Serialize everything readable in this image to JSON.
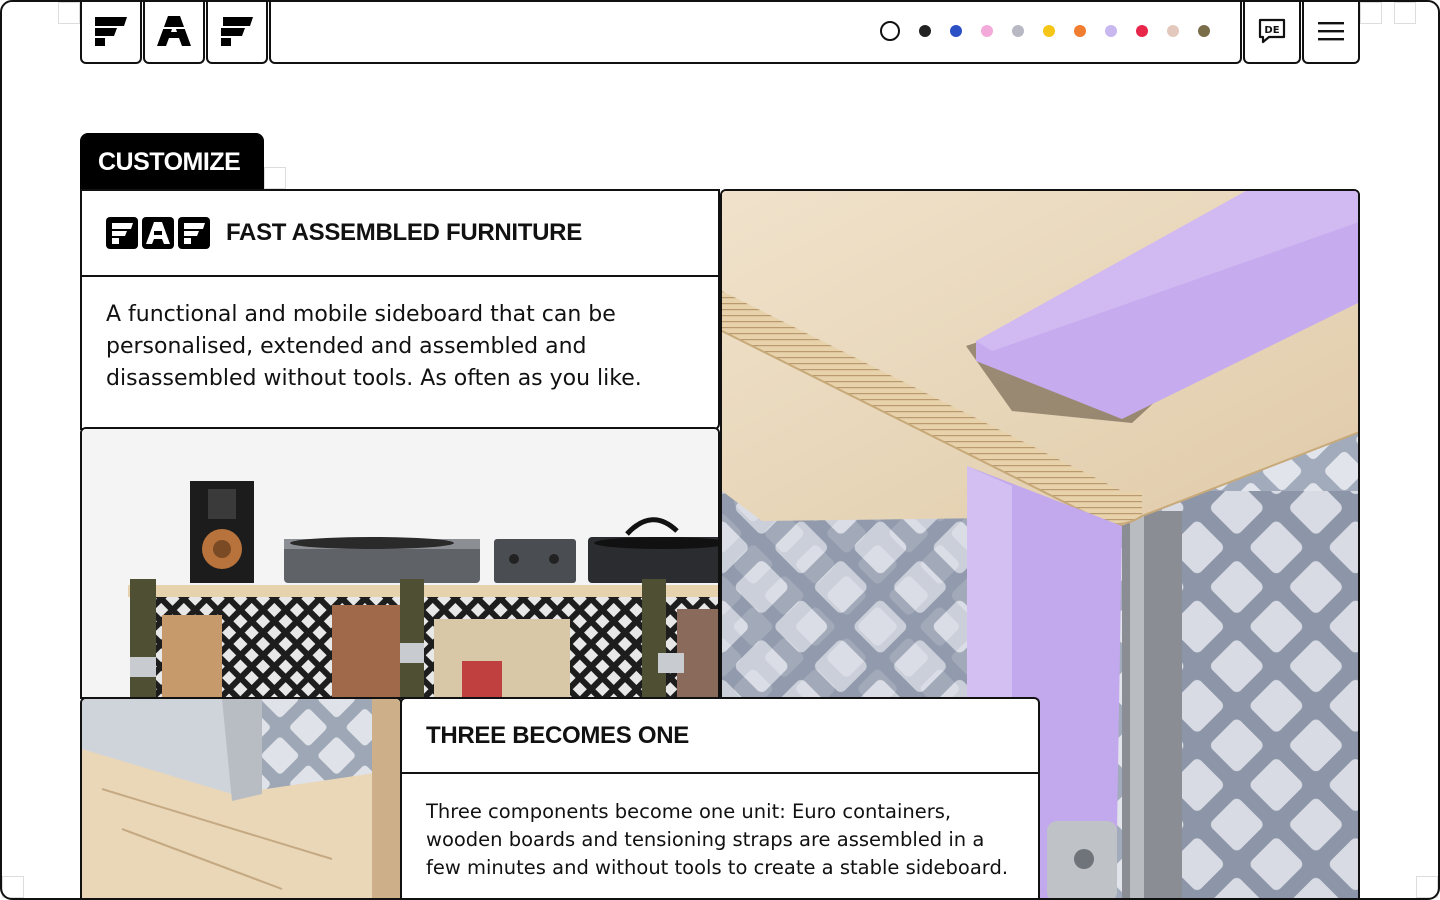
{
  "header": {
    "logo_letters": [
      "F",
      "A",
      "F"
    ],
    "color_swatches": [
      {
        "name": "white",
        "color": "#ffffff",
        "selected": true
      },
      {
        "name": "black",
        "color": "#222222"
      },
      {
        "name": "blue",
        "color": "#2b4fc4"
      },
      {
        "name": "pink",
        "color": "#f3a9d9"
      },
      {
        "name": "grey",
        "color": "#b8b8c4"
      },
      {
        "name": "yellow",
        "color": "#f5c518"
      },
      {
        "name": "orange",
        "color": "#f07d30"
      },
      {
        "name": "lavender",
        "color": "#c9b8ef"
      },
      {
        "name": "red",
        "color": "#e8264a"
      },
      {
        "name": "beige",
        "color": "#e3c9bd"
      },
      {
        "name": "olive",
        "color": "#7a6e4a"
      }
    ],
    "language_label": "DE",
    "icons": {
      "language": "language-bubble-icon",
      "menu": "hamburger-menu-icon"
    }
  },
  "section_tab": "CUSTOMIZE",
  "intro_card": {
    "title": "FAST ASSEMBLED FURNITURE",
    "body": "A functional and mobile sideboard that can be personalised, extended and assembled and disassembled without tools. As often as you like."
  },
  "feature_card": {
    "title": "THREE BECOMES ONE",
    "body": "Three components become one unit: Euro containers, wooden boards and tensioning straps are assembled in a few minutes and without tools to create a stable sideboard."
  },
  "accent_colors": {
    "strap": "#c2a8ec",
    "wood": "#e6d3b6",
    "crate": "#9aa6b8"
  }
}
